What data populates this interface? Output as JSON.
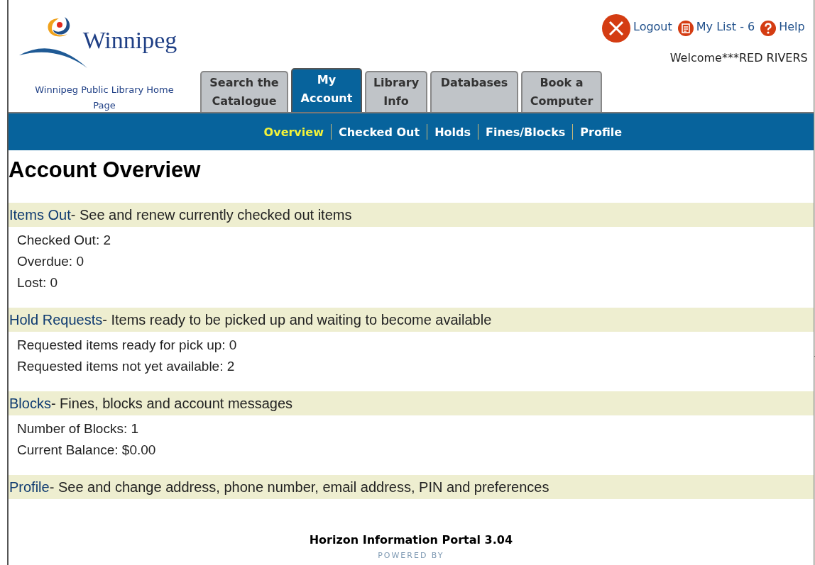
{
  "logo": {
    "wordmark": "Winnipeg",
    "home_link": "Winnipeg Public Library Home Page"
  },
  "top_links": [
    {
      "kind": "logout",
      "label": "Logout"
    },
    {
      "kind": "list",
      "label": "My List - 6"
    },
    {
      "kind": "help",
      "label": "Help"
    }
  ],
  "welcome": "Welcome***RED RIVERS",
  "tabs": [
    {
      "label": "Search the Catalogue",
      "selected": false
    },
    {
      "label": "My Account",
      "selected": true
    },
    {
      "label": "Library Info",
      "selected": false
    },
    {
      "label": "Databases",
      "selected": false
    },
    {
      "label": "Book a Computer",
      "selected": false
    }
  ],
  "subnav": [
    {
      "label": "Overview",
      "selected": true
    },
    {
      "label": "Checked Out",
      "selected": false
    },
    {
      "label": "Holds",
      "selected": false
    },
    {
      "label": "Fines/Blocks",
      "selected": false
    },
    {
      "label": "Profile",
      "selected": false
    }
  ],
  "heading": "Account Overview",
  "sections": [
    {
      "title": "Items Out",
      "description": "- See and renew currently checked out items",
      "lines": [
        "Checked Out: 2",
        "Overdue: 0",
        "Lost: 0"
      ]
    },
    {
      "title": "Hold Requests",
      "description": "- Items ready to be picked up and waiting to become available",
      "lines": [
        "Requested items ready for pick up: 0",
        "Requested items not yet available: 2"
      ]
    },
    {
      "title": "Blocks",
      "description": "- Fines, blocks and account messages",
      "lines": [
        "Number of Blocks: 1",
        "Current Balance: $0.00"
      ]
    },
    {
      "title": "Profile",
      "description": "- See and change address, phone number, email address, PIN and preferences"
    }
  ],
  "footer": {
    "product": "Horizon Information Portal 3.04",
    "powered_by": "POWERED BY"
  }
}
